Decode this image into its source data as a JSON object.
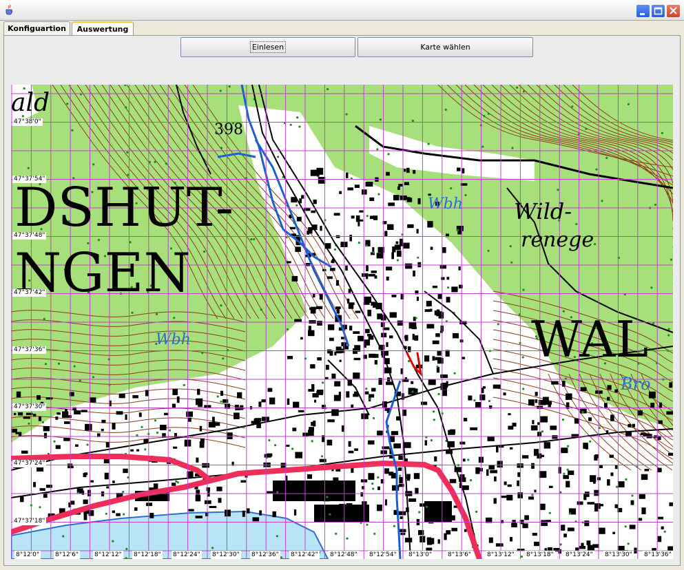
{
  "window": {
    "icon": "java-cup-icon",
    "controls": [
      "minimize-icon",
      "maximize-icon",
      "close-icon"
    ]
  },
  "tabs": [
    {
      "label": "Konfiguartion",
      "selected": false
    },
    {
      "label": "Auswertung",
      "selected": true
    }
  ],
  "toolbar": {
    "read_label": "Einlesen",
    "choose_map_label": "Karte wählen"
  },
  "map": {
    "lat_labels": [
      "47°38'0\"",
      "47°37'54\"",
      "47°37'48\"",
      "47°37'42\"",
      "47°37'36\"",
      "47°37'30\"",
      "47°37'24\"",
      "47°37'18\""
    ],
    "lon_labels": [
      "8°12'0\"",
      "8°12'6\"",
      "8°12'12\"",
      "8°12'18\"",
      "8°12'24\"",
      "8°12'30\"",
      "8°12'36\"",
      "8°12'42\"",
      "8°12'48\"",
      "8°12'54\"",
      "8°13'0\"",
      "8°13'6\"",
      "8°13'12\"",
      "8°13'18\"",
      "8°13'24\"",
      "8°13'30\"",
      "8°13'36\""
    ],
    "place_names": [
      {
        "text": "DSHUT-"
      },
      {
        "text": "NGEN"
      },
      {
        "text": "WAL"
      },
      {
        "text": "Wild-"
      },
      {
        "text": "renege"
      },
      {
        "text": "Wbh"
      },
      {
        "text": "Wbh"
      },
      {
        "text": "Bro"
      },
      {
        "text": "ald"
      },
      {
        "text": "398"
      }
    ],
    "colors": {
      "forest": "#a7e07a",
      "grid": "#c040d0",
      "track": "#ee2d58",
      "water": "#1a5fd0",
      "contours": "#8b3a1a"
    }
  }
}
